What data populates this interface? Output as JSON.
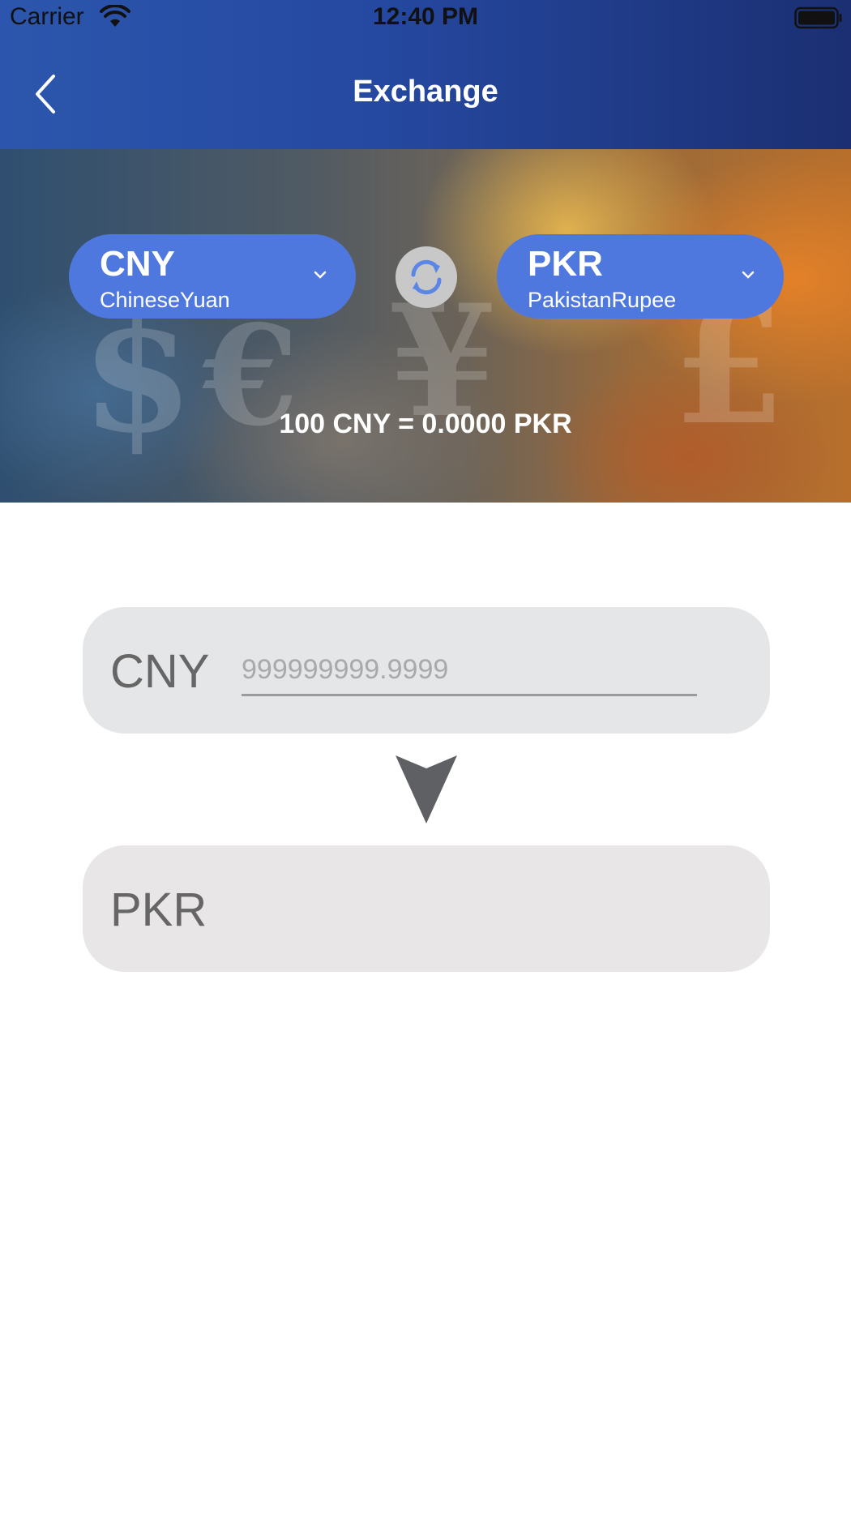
{
  "status_bar": {
    "carrier": "Carrier",
    "time": "12:40 PM",
    "wifi_icon": "wifi-icon",
    "battery_icon": "battery-icon"
  },
  "nav": {
    "back_icon": "chevron-left-icon",
    "title": "Exchange"
  },
  "banner": {
    "from_currency": {
      "code": "CNY",
      "name": "ChineseYuan",
      "icon": "chevron-down-icon"
    },
    "to_currency": {
      "code": "PKR",
      "name": "PakistanRupee",
      "icon": "chevron-down-icon"
    },
    "swap_icon": "refresh-icon",
    "rate": "100 CNY = 0.0000 PKR"
  },
  "converter": {
    "from_code": "CNY",
    "amount_value": "",
    "amount_placeholder": "999999999.9999",
    "arrow_icon": "arrow-down-icon",
    "to_code": "PKR",
    "result_value": ""
  },
  "colors": {
    "header": "#2548a0",
    "pill": "#4f78de",
    "card": "#e5e6e8",
    "label": "#666666"
  }
}
